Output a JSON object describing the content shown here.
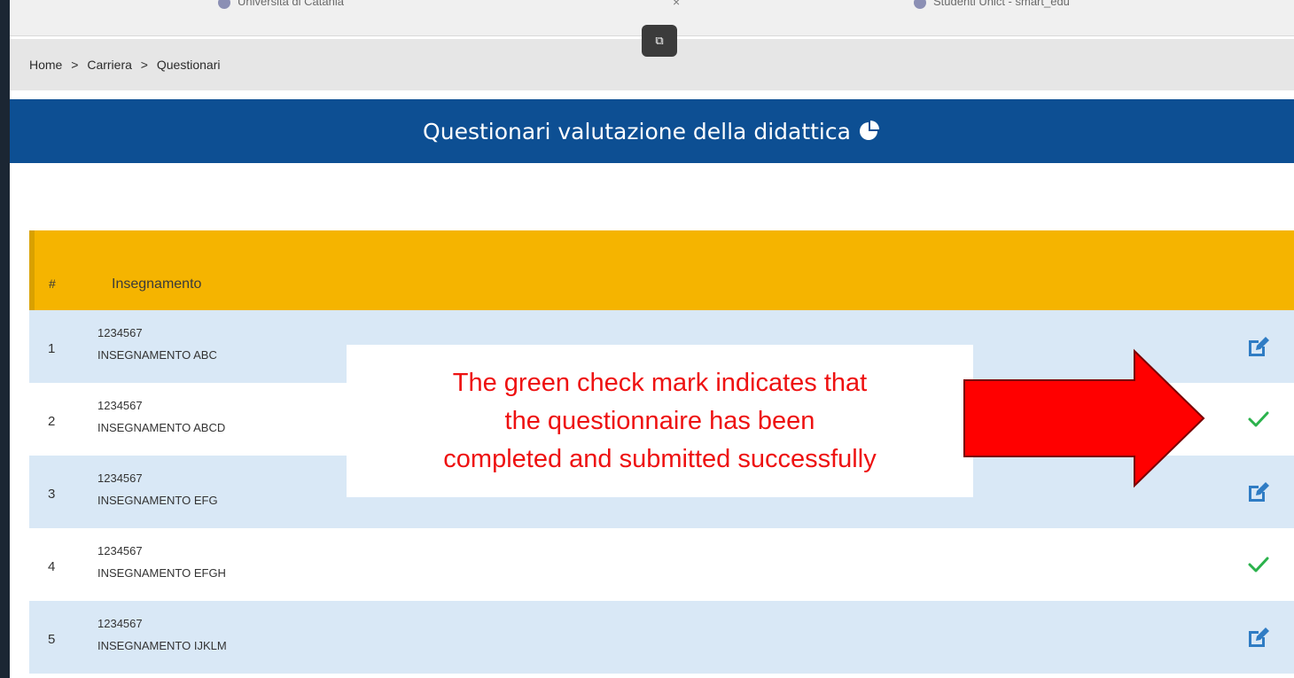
{
  "browser": {
    "tabs": [
      {
        "label": "Università di Catania"
      },
      {
        "label": "Studenti Unict - smart_edu"
      }
    ],
    "tab_close_glyph": "×",
    "pip_glyph": "⧉"
  },
  "breadcrumb": {
    "items": [
      "Home",
      "Carriera",
      "Questionari"
    ],
    "separator": ">"
  },
  "header": {
    "title": "Questionari valutazione della didattica",
    "title_icon": "pie-chart-icon"
  },
  "table": {
    "columns": [
      "#",
      "Insegnamento"
    ],
    "rows": [
      {
        "index": "1",
        "code": "1234567",
        "name": "INSEGNAMENTO ABC",
        "status": "edit-icon"
      },
      {
        "index": "2",
        "code": "1234567",
        "name": "INSEGNAMENTO ABCD",
        "status": "check-icon"
      },
      {
        "index": "3",
        "code": "1234567",
        "name": "INSEGNAMENTO EFG",
        "status": "edit-icon"
      },
      {
        "index": "4",
        "code": "1234567",
        "name": "INSEGNAMENTO EFGH",
        "status": "check-icon"
      },
      {
        "index": "5",
        "code": "1234567",
        "name": "INSEGNAMENTO IJKLM",
        "status": "edit-icon"
      }
    ]
  },
  "annotation": {
    "text": "The green check mark indicates that\nthe questionnaire has been\ncompleted and submitted successfully"
  },
  "colors": {
    "title_bar": "#0d4f93",
    "table_header": "#f5b400",
    "row_alt": "#d9e8f6",
    "edit_icon": "#2f7cc4",
    "check_icon": "#2bb24c",
    "callout_text": "#ee1111",
    "arrow": "#ff0000"
  }
}
